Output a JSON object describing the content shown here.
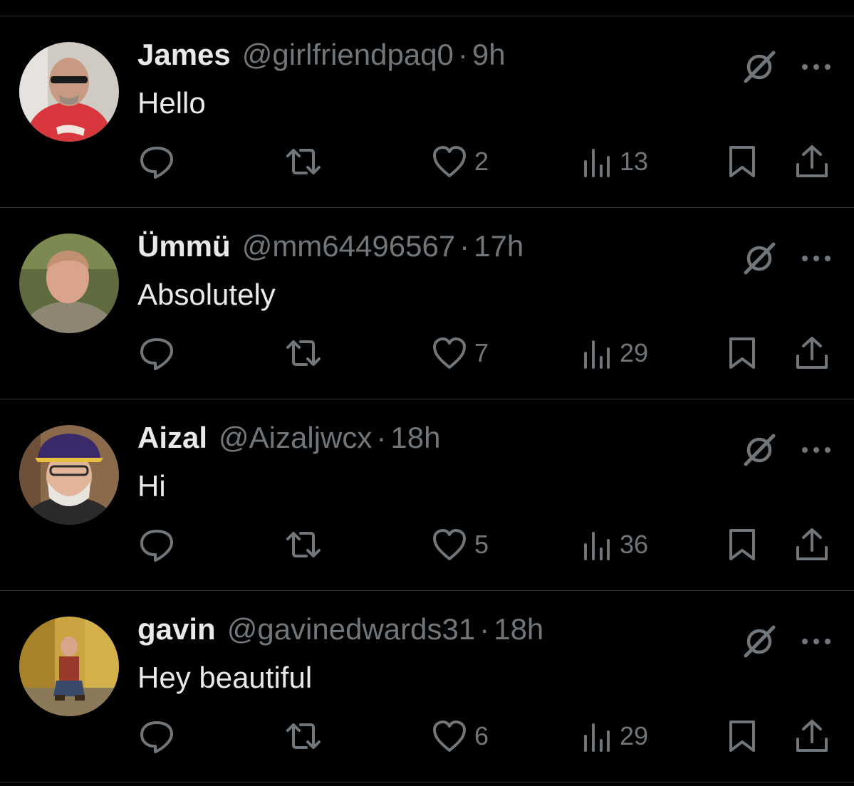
{
  "colors": {
    "background": "#000000",
    "text": "#e7e9ea",
    "muted": "#71767b",
    "divider": "#2f3336"
  },
  "icons": {
    "reply": "reply-icon",
    "repost": "repost-icon",
    "like": "heart-icon",
    "views": "views-icon",
    "bookmark": "bookmark-icon",
    "share": "share-icon",
    "grok": "grok-icon",
    "more": "more-icon"
  },
  "replies": [
    {
      "name": "James",
      "handle": "@girlfriendpaq0",
      "separator": "·",
      "time": "9h",
      "text": "Hello",
      "likes": "2",
      "views": "13"
    },
    {
      "name": "Ümmü",
      "handle": "@mm64496567",
      "separator": "·",
      "time": "17h",
      "text": "Absolutely",
      "likes": "7",
      "views": "29"
    },
    {
      "name": "Aizal",
      "handle": "@Aizaljwcx",
      "separator": "·",
      "time": "18h",
      "text": "Hi",
      "likes": "5",
      "views": "36"
    },
    {
      "name": "gavin",
      "handle": "@gavinedwards31",
      "separator": "·",
      "time": "18h",
      "text": "Hey beautiful",
      "likes": "6",
      "views": "29"
    }
  ]
}
